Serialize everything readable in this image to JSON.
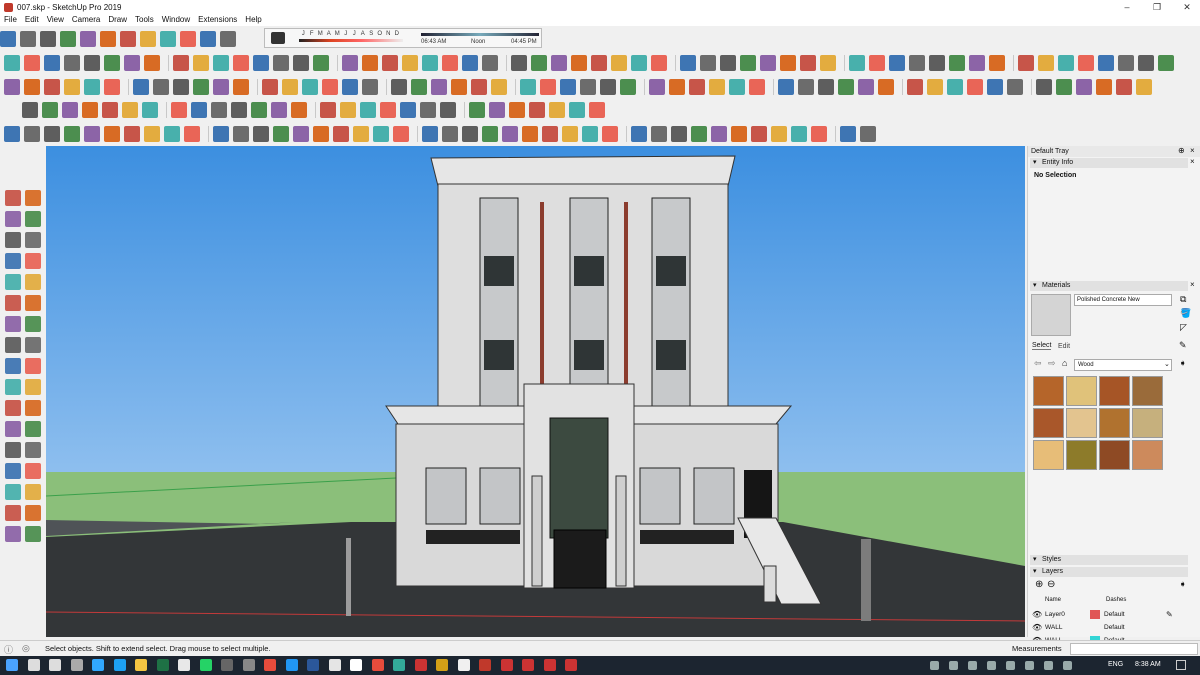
{
  "window": {
    "title": "007.skp - SketchUp Pro 2019"
  },
  "menu": [
    "File",
    "Edit",
    "View",
    "Camera",
    "Draw",
    "Tools",
    "Window",
    "Extensions",
    "Help"
  ],
  "shadow_settings": {
    "months": [
      "J",
      "F",
      "M",
      "A",
      "M",
      "J",
      "J",
      "A",
      "S",
      "O",
      "N",
      "D"
    ],
    "time_start": "06:43 AM",
    "time_noon": "Noon",
    "time_end": "04:45 PM"
  },
  "tray": {
    "title": "Default Tray",
    "entity_info": {
      "header": "Entity Info",
      "selection": "No Selection"
    },
    "materials": {
      "header": "Materials",
      "material_name": "Polished Concrete New",
      "tab_select": "Select",
      "tab_edit": "Edit",
      "library": "Wood",
      "swatches": [
        "#b5652a",
        "#e0c27a",
        "#a65526",
        "#9a6b3a",
        "#a9572a",
        "#e3c48f",
        "#b0722f",
        "#c6b07d",
        "#e7bd78",
        "#8d7b2a",
        "#8e4a24",
        "#cd8a5c"
      ]
    },
    "styles": {
      "header": "Styles"
    },
    "layers": {
      "header": "Layers",
      "col_name": "Name",
      "col_dashes": "Dashes",
      "rows": [
        {
          "name": "Layer0",
          "dashes": "Default",
          "color": "#e05656"
        },
        {
          "name": "WALL",
          "dashes": "Default",
          "color": "#f3f3f3"
        },
        {
          "name": "WALL",
          "dashes": "Default",
          "color": "#33d5d5"
        }
      ]
    }
  },
  "status": {
    "hint": "Select objects. Shift to extend select. Drag mouse to select multiple.",
    "measurements_label": "Measurements"
  },
  "taskbar": {
    "language": "ENG",
    "time": "8:38 AM"
  },
  "colors": {
    "sky": "#5ea4e8",
    "ground": "#8c8c8c",
    "toolbar_bg": "#f0f0f0",
    "accent_red": "#c0392b"
  }
}
